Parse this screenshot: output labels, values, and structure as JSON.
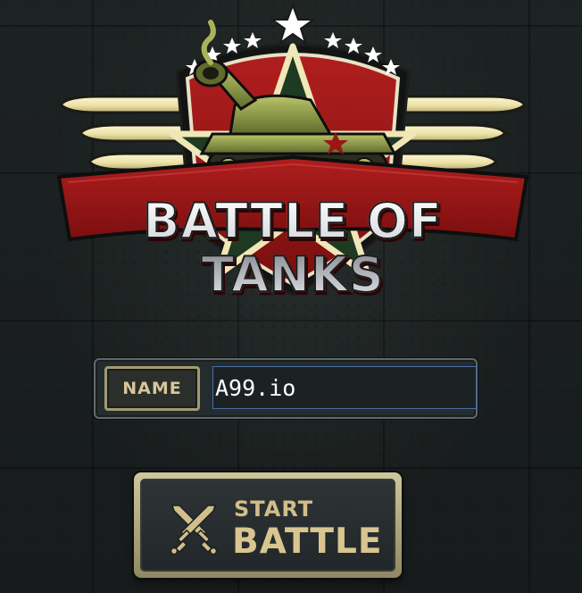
{
  "logo": {
    "title": "BATTLE OF TANKS"
  },
  "name_row": {
    "label": "NAME",
    "value": "A99.io"
  },
  "start_button": {
    "line1": "START",
    "line2": "BATTLE"
  },
  "colors": {
    "banner_red": "#9a1717",
    "star_green": "#1f3a22",
    "gold": "#d9c58f",
    "cream": "#efe7b8",
    "input_border": "#4a6ea8"
  },
  "icons": {
    "start_button_icon": "crossed-swords-icon",
    "logo_emblem": "tank-icon"
  }
}
